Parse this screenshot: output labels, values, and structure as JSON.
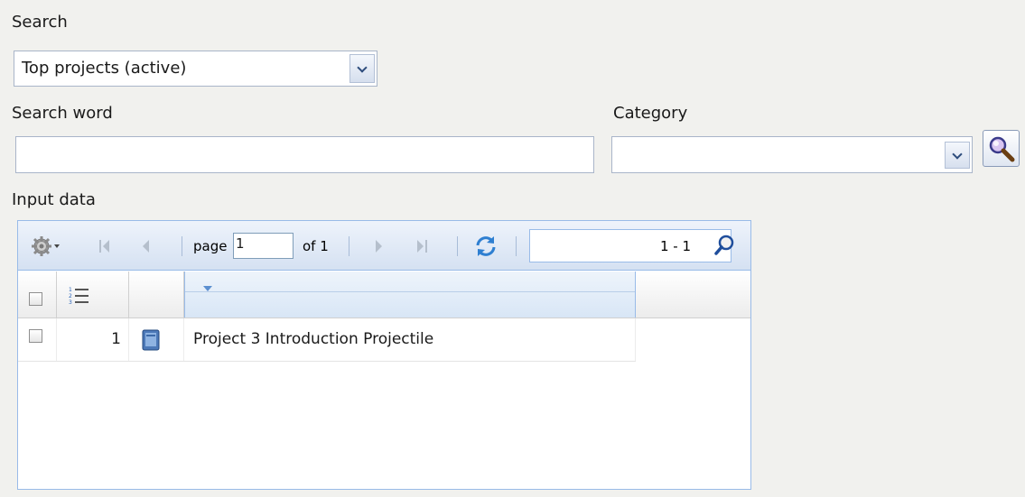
{
  "search": {
    "label": "Search",
    "selected": "Top projects (active)"
  },
  "search_word": {
    "label": "Search word",
    "value": ""
  },
  "category": {
    "label": "Category",
    "value": ""
  },
  "input_data": {
    "label": "Input data",
    "pager": {
      "page_label": "page",
      "page_value": "1",
      "of_label": "of 1",
      "range_text": "1 - 1"
    },
    "rows": [
      {
        "num": "1",
        "title": "Project 3 Introduction Projectile",
        "checked": false
      }
    ]
  },
  "icons": {
    "settings": "gear-icon",
    "first": "first-page-icon",
    "prev": "prev-page-icon",
    "next": "next-page-icon",
    "last": "last-page-icon",
    "refresh": "refresh-icon",
    "search": "magnifier-icon",
    "numbering": "numbered-list-icon",
    "document": "book-icon"
  },
  "colors": {
    "panel_border": "#99bbe8",
    "background": "#f1f1ee",
    "accent": "#2d4c7c"
  }
}
